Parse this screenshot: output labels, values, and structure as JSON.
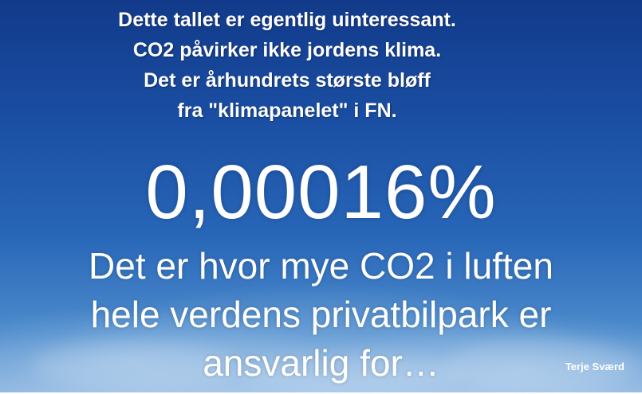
{
  "headline": {
    "lines": [
      "Dette tallet er egentlig uinteressant.",
      "CO2 påvirker ikke jordens klima.",
      "Det er århundrets største bløff",
      "fra \"klimapanelet\" i FN."
    ]
  },
  "main": {
    "number": "0,00016%",
    "lines": [
      "Det er hvor mye CO2 i luften",
      "hele verdens privatbilpark er",
      "ansvarlig for…"
    ]
  },
  "author": "Terje Sværd",
  "colors": {
    "sky_top": "#123a8a",
    "sky_bottom": "#8fb7e0",
    "text": "#ffffff"
  }
}
